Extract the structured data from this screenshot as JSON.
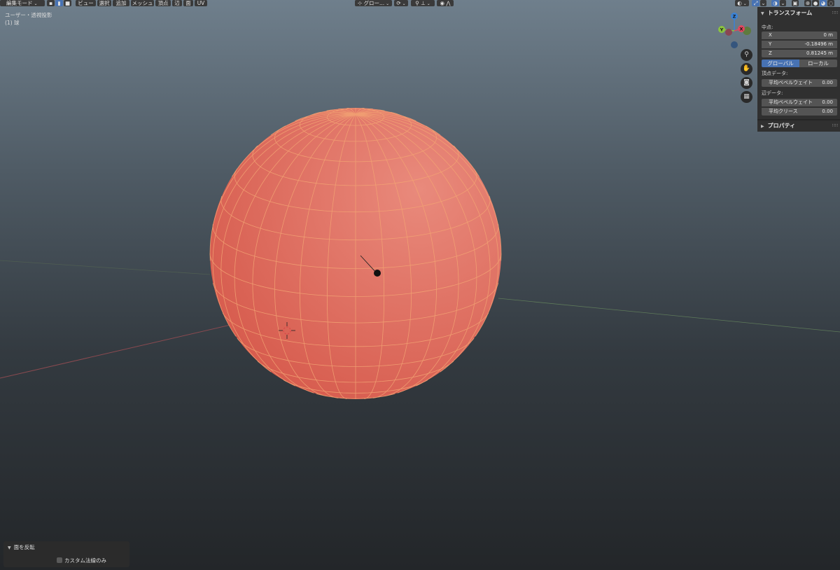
{
  "header": {
    "mode": "編集モード",
    "menus": [
      "ビュー",
      "選択",
      "追加",
      "メッシュ",
      "頂点",
      "辺",
      "面",
      "UV"
    ],
    "orientation": "グロー...",
    "select_modes": [
      "vertex-select-icon",
      "edge-select-icon",
      "face-select-icon"
    ]
  },
  "viewport": {
    "view_name": "ユーザー・透視投影",
    "object_name": "(1) 球"
  },
  "gizmo": {
    "x": "X",
    "y": "Y",
    "z": "Z"
  },
  "npanel": {
    "transform_title": "トランスフォーム",
    "median_label": "中点:",
    "x_label": "X",
    "x_value": "0 m",
    "y_label": "Y",
    "y_value": "-0.18496 m",
    "z_label": "Z",
    "z_value": "0.81245 m",
    "global_label": "グローバル",
    "local_label": "ローカル",
    "vertex_data_label": "頂点データ:",
    "vertex_bevel_label": "平均ベベルウェイト",
    "vertex_bevel_value": "0.00",
    "edge_data_label": "辺データ:",
    "edge_bevel_label": "平均ベベルウェイト",
    "edge_bevel_value": "0.00",
    "crease_label": "平均クリース",
    "crease_value": "0.00",
    "properties_title": "プロパティ"
  },
  "operator": {
    "title": "面を反転",
    "checkbox_label": "カスタム法線のみ",
    "checkbox_checked": false
  },
  "colors": {
    "sphere_face": "#e07060",
    "wire": "#f3a574",
    "accent": "#4772b3",
    "x_axis": "#e0485f",
    "y_axis": "#8bc43f",
    "z_axis": "#3b83d6"
  }
}
